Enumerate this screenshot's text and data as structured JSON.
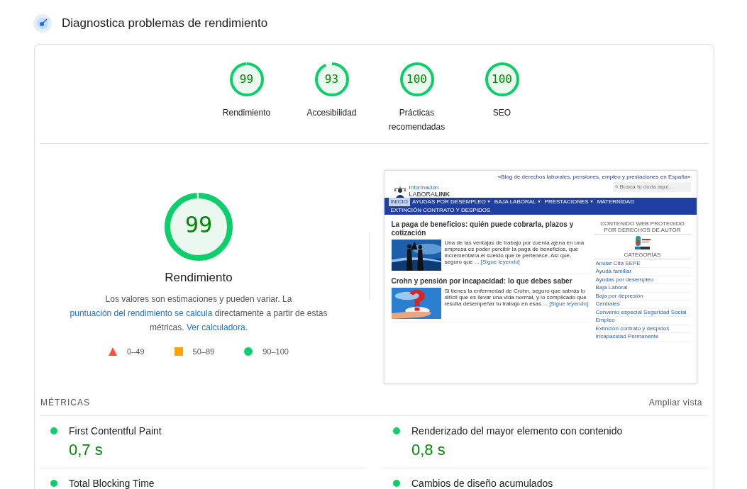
{
  "header": {
    "title": "Diagnostica problemas de rendimiento"
  },
  "categories": [
    {
      "score": "99",
      "label": "Rendimiento",
      "level": 0.99
    },
    {
      "score": "93",
      "label": "Accesibilidad",
      "level": 0.93
    },
    {
      "score": "100",
      "label": "Prácticas recomendadas",
      "level": 1
    },
    {
      "score": "100",
      "label": "SEO",
      "level": 1
    }
  ],
  "main": {
    "score": "99",
    "level": 0.99,
    "title": "Rendimiento",
    "description": [
      {
        "text": "Los valores son estimaciones y pueden variar. La ",
        "link": false
      },
      {
        "text": "puntuación del rendimiento se calcula",
        "link": true
      },
      {
        "text": " directamente a partir de estas métricas. ",
        "link": false
      },
      {
        "text": "Ver calculadora.",
        "link": true
      }
    ],
    "legend": [
      {
        "kind": "fail",
        "range": "0–49"
      },
      {
        "kind": "average",
        "range": "50–89"
      },
      {
        "kind": "pass",
        "range": "90–100"
      }
    ]
  },
  "preview": {
    "logo_top": "Información",
    "logo_bottom": "LABORA**LINK**",
    "tagline": "«Blog de derechos laborales, pensiones, empleo y prestaciones en España»",
    "search_placeholder": "Busca tu duda aquí...",
    "nav": [
      {
        "label": "INICIO",
        "selected": true,
        "has_menu": false
      },
      {
        "label": "AYUDAS POR DESEMPLEO",
        "selected": false,
        "has_menu": true
      },
      {
        "label": "BAJA LABORAL",
        "selected": false,
        "has_menu": true
      },
      {
        "label": "PRESTACIONES",
        "selected": false,
        "has_menu": true
      },
      {
        "label": "MATERNIDAD",
        "selected": false,
        "has_menu": false
      },
      {
        "label": "EXTINCIÓN CONTRATO Y DESPIDOS",
        "selected": false,
        "has_menu": false
      }
    ],
    "posts": [
      {
        "title": "La paga de beneficios: quién puede cobrarla, plazos y cotización",
        "excerpt": "Una de las ventajas de trabajo por cuenta ajena en una empresa es poder percibir la paga de beneficios, que incrementaría el sueldo que te pertenece. Así que, seguro que ...",
        "more": "[Sigue leyendo]"
      },
      {
        "title": "Crohn y pensión por incapacidad: lo que debes saber",
        "excerpt": "Si tienes la enfermedad de Crohn, seguro que sabrás lo difícil que es llevar una vida normal, y lo complicado que resulta desempeñar tu trabajo en esas ...",
        "more": "[Sigue leyendo]"
      }
    ],
    "copyright_title": "CONTENIDO WEB PROTEGIDO POR DERECHOS DE AUTOR",
    "categories_title": "CATEGORÍAS",
    "categories": [
      "Anular Cita SEPE",
      "Ayuda familiar",
      "Ayudas por desempleo",
      "Baja Laboral",
      "Baja por depresión",
      "Centrales",
      "Convenio especial Seguridad Social",
      "Empleo",
      "Extinción contrato y despidos",
      "Incapacidad Permanente"
    ]
  },
  "metrics": {
    "title": "MÉTRICAS",
    "expand_label": "Ampliar vista",
    "items": [
      {
        "name": "First Contentful Paint",
        "value": "0,7 s",
        "kind": "pass"
      },
      {
        "name": "Renderizado del mayor elemento con contenido",
        "value": "0,8 s",
        "kind": "pass"
      },
      {
        "name": "Total Blocking Time",
        "kind": "pass"
      },
      {
        "name": "Cambios de diseño acumulados",
        "kind": "pass"
      }
    ]
  }
}
